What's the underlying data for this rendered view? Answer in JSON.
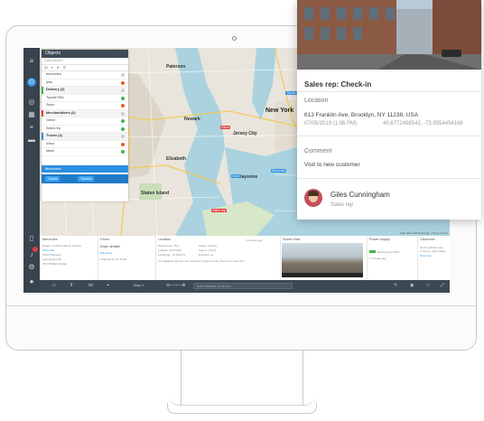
{
  "objects_panel": {
    "title": "Objects",
    "search_placeholder": "Quick search",
    "tools": [
      "All",
      "▾",
      "⚙",
      "☰"
    ],
    "rows": [
      {
        "label": "mercedes",
        "type": "item",
        "dot": "#cfcfcf"
      },
      {
        "label": "john",
        "type": "item",
        "dot": "#ea5b2a"
      },
      {
        "label": "Delivery (3)",
        "type": "group",
        "color": "#47b34a",
        "dot": "#cfcfcf"
      },
      {
        "label": "Toyota RAV",
        "type": "item",
        "dot": "#47b34a"
      },
      {
        "label": "Scion",
        "type": "item",
        "dot": "#ea5b2a"
      },
      {
        "label": "Merchandisers (2)",
        "type": "group",
        "color": "#e04040",
        "dot": "#cfcfcf"
      },
      {
        "label": "Glenn",
        "type": "item",
        "dot": "#47b34a"
      },
      {
        "label": "Sales rep",
        "type": "item",
        "dot": "#47b34a"
      },
      {
        "label": "Trucks (3)",
        "type": "group",
        "color": "#2d8fe0",
        "dot": "#cfcfcf"
      },
      {
        "label": "Volvo",
        "type": "item",
        "dot": "#ea5b2a"
      },
      {
        "label": "Mack",
        "type": "item",
        "dot": "#47b34a"
      }
    ],
    "selected": "Mercedes",
    "buttons": [
      "Tracks",
      "Tunnels"
    ]
  },
  "map": {
    "labels": [
      "New York",
      "Newark",
      "Elizabeth",
      "Staten Island",
      "Bayonne",
      "Jersey City",
      "Paterson"
    ],
    "markers": [
      {
        "label": "Toyota RAV",
        "color": "#2d8fe0"
      },
      {
        "label": "Glenn",
        "color": "#e04040"
      },
      {
        "label": "Mercedes",
        "color": "#2d8fe0"
      },
      {
        "label": "Volvo",
        "color": "#2d8fe0"
      },
      {
        "label": "Sales rep",
        "color": "#e04040"
      }
    ],
    "footer": "Map data ©2019 Google | Terms of Use"
  },
  "info_panel": {
    "vehicle": {
      "title": "Mercedes",
      "lines": [
        "Ready 1.0 KPH Fashion Avenue",
        "Price sale",
        "$ 500 (Sample)",
        "Last signal 0:45",
        "25 VOSSER ApHalp"
      ]
    },
    "driver": {
      "title": "Driver",
      "name": "Doyle Jennifer",
      "edit": "Edit driver",
      "changed": "Changed by W. Smith"
    },
    "location": {
      "title": "Location",
      "time": "2 minutes ago",
      "lines": [
        "Signal level: 75%",
        "Latitude: 40.677467",
        "Longitude: -74.003774",
        "271 Madison Avenue, Fort Hamilton, Kings County, New York, New York"
      ],
      "status": [
        "Status: Moving",
        "Speed: 1 km/h",
        "Direction: ▲"
      ]
    },
    "street_view": {
      "title": "Street View"
    },
    "power_supply": {
      "title": "Power supply",
      "battery": "Battery level: 65%",
      "time": "2 minutes ago"
    },
    "odometer": {
      "title": "Odometer",
      "lines": [
        "Set the odometer value",
        "in “Device” object settings",
        "Show more"
      ]
    }
  },
  "toolbar": {
    "map_label": "Map 1",
    "address_placeholder": "Enter address or lat, lon..."
  },
  "checkin_card": {
    "title": "Sales rep: Check-in",
    "location_label": "Location",
    "address": "613 Franklin Ave, Brooklyn, NY 11238, USA",
    "datetime": "07/05/2019 (1:06 PM)",
    "coords": "40.6772408542, -73.9554454168",
    "comment_label": "Comment",
    "comment": "Visit to new customer",
    "user_name": "Giles Cunningham",
    "user_role": "Sales rep"
  }
}
